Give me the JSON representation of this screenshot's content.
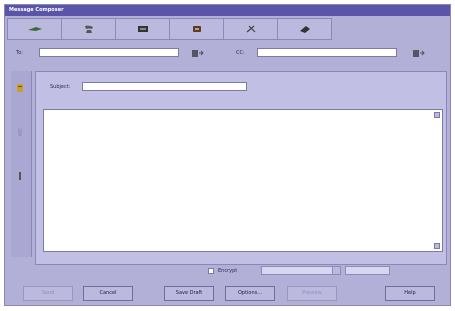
{
  "window": {
    "title": "Message Composer"
  },
  "toolbar": {
    "buttons": [
      {
        "icon": "send-icon"
      },
      {
        "icon": "phone-icon"
      },
      {
        "icon": "message-icon"
      },
      {
        "icon": "record-icon"
      },
      {
        "icon": "tools-icon"
      },
      {
        "icon": "erase-icon"
      }
    ]
  },
  "to": {
    "label": "To:",
    "value": ""
  },
  "cc": {
    "label": "CC:",
    "value": ""
  },
  "subject": {
    "label": "Subject:",
    "value": ""
  },
  "body": {
    "value": ""
  },
  "sidebar": {
    "icons": [
      "attach-icon",
      "clip-icon",
      "pin-icon"
    ]
  },
  "options": {
    "checkbox_label": "Encrypt",
    "select1": "",
    "select2": ""
  },
  "buttons": {
    "send": "Send",
    "cancel": "Cancel",
    "save_draft": "Save Draft",
    "options": "Options...",
    "preview": "Preview",
    "help": "Help"
  },
  "colors": {
    "window_bg": "#b3b0d8",
    "title_bg": "#5a55a8",
    "panel_bg": "#c2bfe4"
  }
}
